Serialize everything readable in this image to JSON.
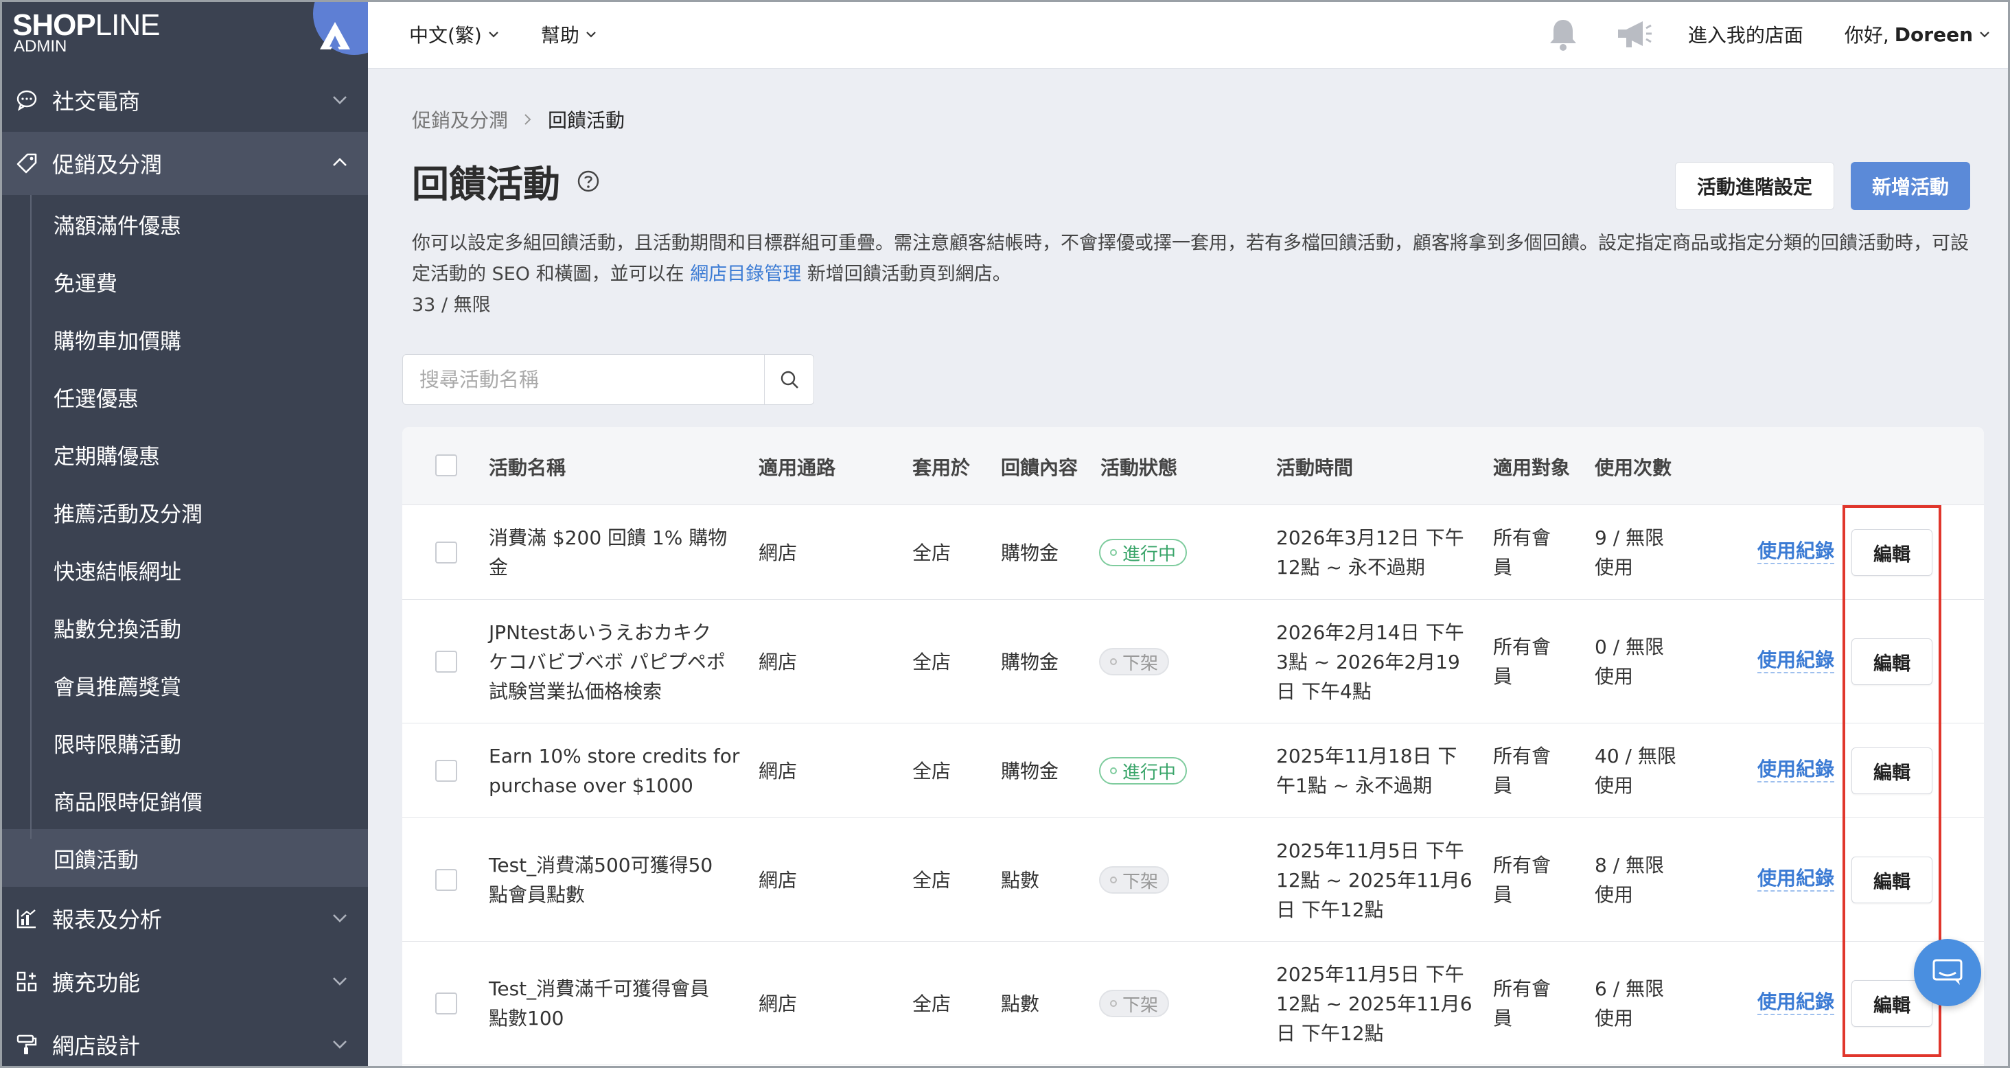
{
  "logo": {
    "brand_bold": "SHOP",
    "brand_thin": "LINE",
    "sub": "ADMIN"
  },
  "sidebar": {
    "sections_top": [
      {
        "label": "社交電商",
        "icon": "chat-bubble-icon",
        "expanded": false
      }
    ],
    "active_section": {
      "label": "促銷及分潤",
      "icon": "tag-icon",
      "expanded": true
    },
    "sub_items": [
      "滿額滿件優惠",
      "免運費",
      "購物車加價購",
      "任選優惠",
      "定期購優惠",
      "推薦活動及分潤",
      "快速結帳網址",
      "點數兌換活動",
      "會員推薦獎賞",
      "限時限購活動",
      "商品限時促銷價",
      "回饋活動"
    ],
    "current_sub": "回饋活動",
    "sections_bottom": [
      {
        "label": "報表及分析",
        "icon": "chart-icon"
      },
      {
        "label": "擴充功能",
        "icon": "grid-icon"
      },
      {
        "label": "網店設計",
        "icon": "paint-roller-icon"
      }
    ]
  },
  "topbar": {
    "language": "中文(繁)",
    "help": "幫助",
    "store_link": "進入我的店面",
    "greeting": "你好,",
    "user": "Doreen"
  },
  "breadcrumb": {
    "parent": "促銷及分潤",
    "current": "回饋活動"
  },
  "page": {
    "title": "回饋活動",
    "adv_button": "活動進階設定",
    "new_button": "新增活動",
    "desc_part1": "你可以設定多組回饋活動，且活動期間和目標群組可重疊。需注意顧客結帳時，不會擇優或擇一套用，若有多檔回饋活動，顧客將拿到多個回饋。設定指定商品或指定分類的回饋活動時，可設定活動的 SEO 和橫圖，並可以在 ",
    "desc_link": "網店目錄管理",
    "desc_part2": " 新增回饋活動頁到網店。",
    "quota": "33 / 無限"
  },
  "search": {
    "placeholder": "搜尋活動名稱"
  },
  "table": {
    "headers": {
      "name": "活動名稱",
      "channel": "適用通路",
      "apply": "套用於",
      "reward": "回饋內容",
      "status": "活動狀態",
      "period": "活動時間",
      "target": "適用對象",
      "usage": "使用次數"
    },
    "rows": [
      {
        "name": [
          "消費滿 $200 回饋 1% 購物",
          "金"
        ],
        "channel": "網店",
        "apply": "全店",
        "reward": "購物金",
        "status": "進行中",
        "status_type": "active",
        "period": [
          "2026年3月12日 下午",
          "12點 ~ 永不過期"
        ],
        "target": [
          "所有會",
          "員"
        ],
        "usage": [
          "9 / 無限",
          "使用"
        ],
        "log": "使用紀錄",
        "edit": "編輯"
      },
      {
        "name": [
          "JPNtestあいうえおカキク",
          "ケコバビブベボ パピプペポ",
          "試験営業払価格検索"
        ],
        "channel": "網店",
        "apply": "全店",
        "reward": "購物金",
        "status": "下架",
        "status_type": "off",
        "period": [
          "2026年2月14日 下午",
          "3點 ~ 2026年2月19",
          "日 下午4點"
        ],
        "target": [
          "所有會",
          "員"
        ],
        "usage": [
          "0 / 無限",
          "使用"
        ],
        "log": "使用紀錄",
        "edit": "編輯"
      },
      {
        "name": [
          "Earn 10% store credits for",
          "purchase over $1000"
        ],
        "channel": "網店",
        "apply": "全店",
        "reward": "購物金",
        "status": "進行中",
        "status_type": "active",
        "period": [
          "2025年11月18日 下",
          "午1點 ~ 永不過期"
        ],
        "target": [
          "所有會",
          "員"
        ],
        "usage": [
          "40 / 無限",
          "使用"
        ],
        "log": "使用紀錄",
        "edit": "編輯"
      },
      {
        "name": [
          "Test_消費滿500可獲得50",
          "點會員點數"
        ],
        "channel": "網店",
        "apply": "全店",
        "reward": "點數",
        "status": "下架",
        "status_type": "off",
        "period": [
          "2025年11月5日 下午",
          "12點 ~ 2025年11月6",
          "日 下午12點"
        ],
        "target": [
          "所有會",
          "員"
        ],
        "usage": [
          "8 / 無限",
          "使用"
        ],
        "log": "使用紀錄",
        "edit": "編輯"
      },
      {
        "name": [
          "Test_消費滿千可獲得會員",
          "點數100"
        ],
        "channel": "網店",
        "apply": "全店",
        "reward": "點數",
        "status": "下架",
        "status_type": "off",
        "period": [
          "2025年11月5日 下午",
          "12點 ~ 2025年11月6",
          "日 下午12點"
        ],
        "target": [
          "所有會",
          "員"
        ],
        "usage": [
          "6 / 無限",
          "使用"
        ],
        "log": "使用紀錄",
        "edit": "編輯"
      }
    ]
  },
  "colors": {
    "primary": "#5b8ad8",
    "sidebar": "#3b4251",
    "link": "#3b7bd4",
    "active_badge": "#3aa56a",
    "highlight": "#e0362c"
  }
}
